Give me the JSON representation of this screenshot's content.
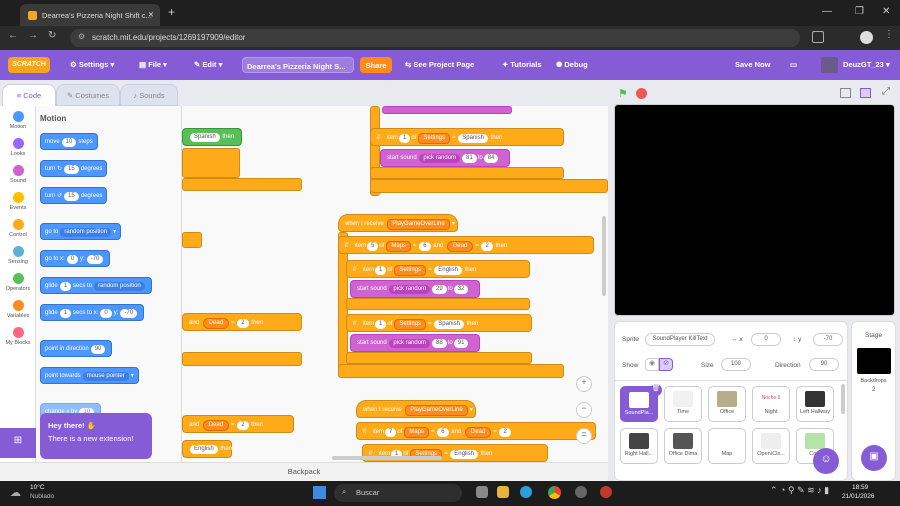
{
  "browser": {
    "tab_title": "Dearrea's Pizzeria Night Shift c...",
    "url": "scratch.mit.edu/projects/1269197909/editor"
  },
  "menu": {
    "logo": "SCRATCH",
    "settings": "Settings",
    "file": "File",
    "edit": "Edit",
    "project_title": "Dearrea's Pizzeria Night S...",
    "share": "Share",
    "see_project_page": "See Project Page",
    "tutorials": "Tutorials",
    "debug": "Debug",
    "save_now": "Save Now",
    "username": "DeuzGT_23"
  },
  "editor_tabs": [
    "Code",
    "Costumes",
    "Sounds"
  ],
  "categories": [
    {
      "label": "Motion",
      "color": "#4c97ff"
    },
    {
      "label": "Looks",
      "color": "#9966ff"
    },
    {
      "label": "Sound",
      "color": "#cf63cf"
    },
    {
      "label": "Events",
      "color": "#ffbf00"
    },
    {
      "label": "Control",
      "color": "#ffab19"
    },
    {
      "label": "Sensing",
      "color": "#5cb1d6"
    },
    {
      "label": "Operators",
      "color": "#59c059"
    },
    {
      "label": "Variables",
      "color": "#ff8c1a"
    },
    {
      "label": "My Blocks",
      "color": "#ff6680"
    }
  ],
  "palette": {
    "heading": "Motion",
    "move_a": "move",
    "move_val": "10",
    "move_b": "steps",
    "turn": "turn",
    "turn_val": "15",
    "degrees": "degrees",
    "goto": "go to",
    "goto_dd": "random position",
    "gotoxy_a": "go to x:",
    "gotoxy_x": "0",
    "gotoxy_y_lbl": "y:",
    "gotoxy_y": "-70",
    "glide": "glide",
    "glide_val": "1",
    "glide_secs": "secs to",
    "glide_dd": "random position",
    "glidexy_secs": "secs to x:",
    "glidexy_x": "0",
    "glidexy_y": "-70",
    "point_dir": "point in direction",
    "point_dir_val": "90",
    "point_towards": "point towards",
    "point_towards_dd": "mouse pointer",
    "change_x": "change x by",
    "change_x_val": "10"
  },
  "workspace": {
    "if": "if",
    "then": "then",
    "item": "item",
    "of": "of",
    "settings": "Settings",
    "spanish": "Spanish",
    "english": "English",
    "and": "and",
    "dead": "Dead",
    "maps": "Maps",
    "start_sound": "start sound",
    "pick_random": "pick random",
    "to": "to",
    "when_receive": "when I receive",
    "msg": "PlayGameOverLine",
    "n1": "1",
    "n2": "2",
    "n5": "5",
    "n6": "6",
    "n7": "7",
    "r81": "81",
    "r84": "84",
    "r29": "29",
    "r32": "32",
    "r88": "88",
    "r91": "91"
  },
  "toast": {
    "title": "Hey there!",
    "text": "There is a new extension!"
  },
  "backpack": "Backpack",
  "sprite_info": {
    "sprite_label": "Sprite",
    "sprite_name": "SoundPlayer KillText",
    "x_label": "x",
    "x": "0",
    "y_label": "y",
    "y": "-70",
    "show_label": "Show",
    "size_label": "Size",
    "size": "100",
    "direction_label": "Direction",
    "direction": "90"
  },
  "sprites": [
    "SoundPla...",
    "Time",
    "Office",
    "Night",
    "Left Hallway",
    "Right Hall...",
    "Office Dima",
    "Map",
    "Open/Cls...",
    "Ca..."
  ],
  "stage_panel": {
    "title": "Stage",
    "backdrops_label": "Backdrops",
    "backdrops_count": "2"
  },
  "taskbar": {
    "temp": "10°C",
    "weather": "Nublado",
    "search": "Buscar",
    "time": "18:59",
    "date": "21/01/2026"
  }
}
